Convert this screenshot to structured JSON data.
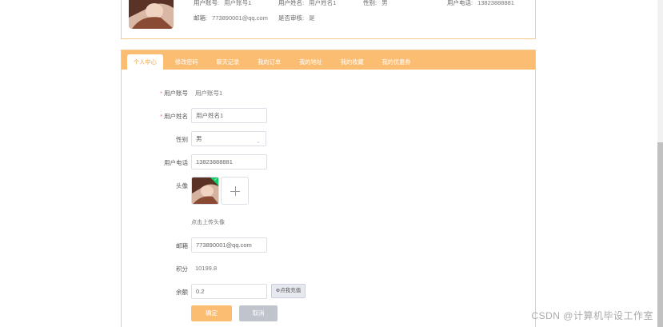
{
  "top_info": {
    "account_label": "用户账号:",
    "account_value": "用户账号1",
    "name_label": "用户姓名:",
    "name_value": "用户姓名1",
    "gender_label": "性别:",
    "gender_value": "男",
    "phone_label": "用户电话:",
    "phone_value": "13823888881",
    "email_label": "邮箱:",
    "email_value": "773890001@qq.com",
    "review_label": "是否审核:",
    "review_value": "是"
  },
  "tabs": [
    {
      "label": "个人中心"
    },
    {
      "label": "修改密码"
    },
    {
      "label": "聊天记录"
    },
    {
      "label": "我的订单"
    },
    {
      "label": "我的地址"
    },
    {
      "label": "我的收藏"
    },
    {
      "label": "我的优惠券"
    }
  ],
  "form": {
    "account_label": "用户账号",
    "account_value": "用户账号1",
    "name_label": "用户姓名",
    "name_value": "用户姓名1",
    "gender_label": "性别",
    "gender_value": "男",
    "phone_label": "用户电话",
    "phone_value": "13823888881",
    "avatar_label": "头像",
    "avatar_hint": "点击上传头像",
    "email_label": "邮箱",
    "email_value": "773890001@qq.com",
    "points_label": "积分",
    "points_value": "10199.8",
    "balance_label": "余额",
    "balance_value": "0.2",
    "recharge_label": "⊕点我充值",
    "confirm_label": "确定",
    "cancel_label": "取消",
    "required_mark": "*"
  },
  "watermark": "CSDN @计算机毕设工作室",
  "colors": {
    "accent": "#fbbd72",
    "accent_text": "#f5a13a",
    "border": "#f6c88f",
    "required": "#f56c6c",
    "upload_badge": "#13ce66"
  },
  "icons": {
    "select_arrow": "chevron-down-icon",
    "upload": "plus-icon",
    "uploaded_badge": "check-icon"
  }
}
